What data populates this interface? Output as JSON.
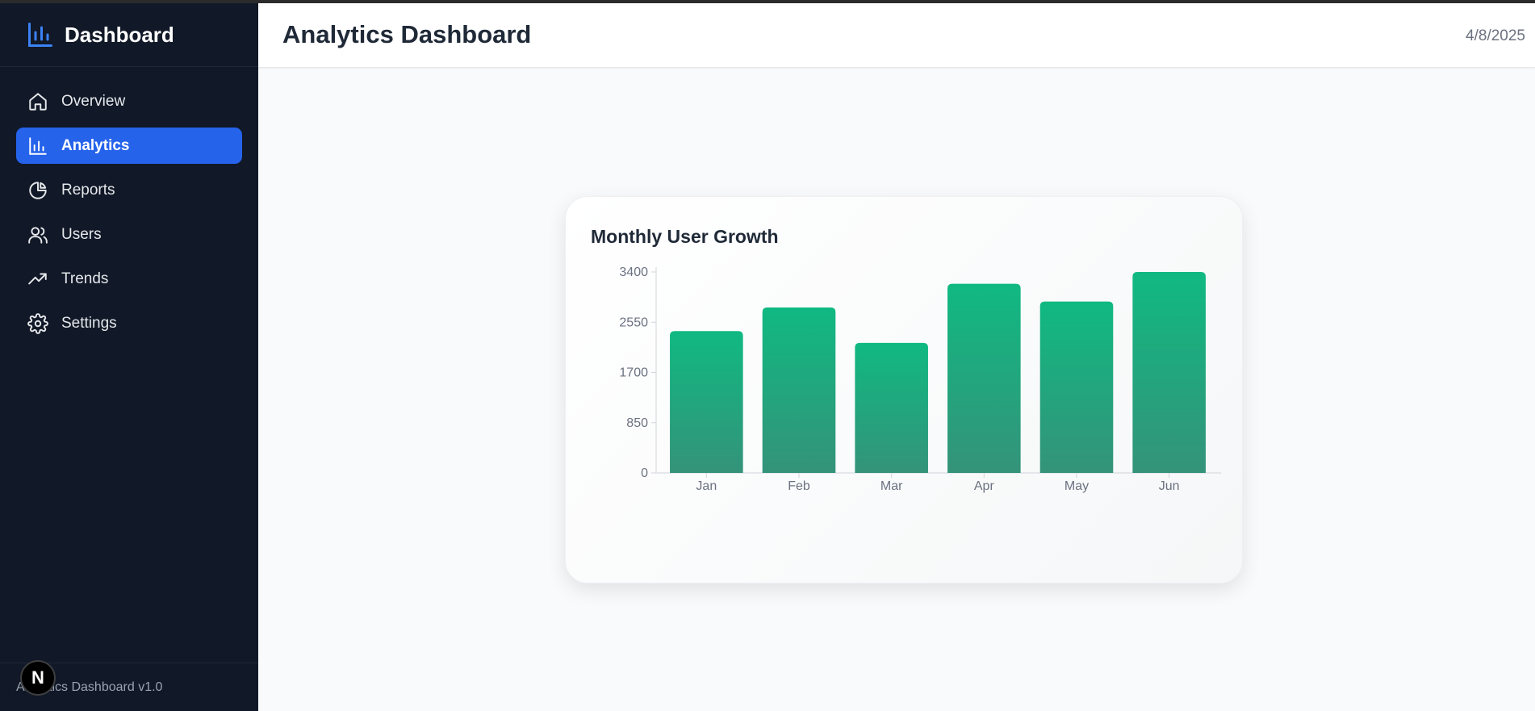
{
  "sidebar": {
    "brand": "Dashboard",
    "items": [
      {
        "label": "Overview",
        "icon": "home-icon"
      },
      {
        "label": "Analytics",
        "icon": "bar-chart-icon",
        "active": true
      },
      {
        "label": "Reports",
        "icon": "pie-chart-icon"
      },
      {
        "label": "Users",
        "icon": "users-icon"
      },
      {
        "label": "Trends",
        "icon": "trending-up-icon"
      },
      {
        "label": "Settings",
        "icon": "gear-icon"
      }
    ],
    "footer": "Analytics Dashboard v1.0"
  },
  "header": {
    "title": "Analytics Dashboard",
    "date": "4/8/2025"
  },
  "card": {
    "title": "Monthly User Growth"
  },
  "colors": {
    "sidebar_bg": "#111827",
    "active_item": "#2563eb",
    "bar_top": "#10b981",
    "bar_bottom": "#34937a"
  },
  "chart_data": {
    "type": "bar",
    "title": "Monthly User Growth",
    "categories": [
      "Jan",
      "Feb",
      "Mar",
      "Apr",
      "May",
      "Jun"
    ],
    "values": [
      2400,
      2800,
      2200,
      3200,
      2900,
      3400
    ],
    "y_ticks": [
      0,
      850,
      1700,
      2550,
      3400
    ],
    "ylim": [
      0,
      3400
    ],
    "grid": false,
    "legend": "none"
  },
  "badge": "N"
}
